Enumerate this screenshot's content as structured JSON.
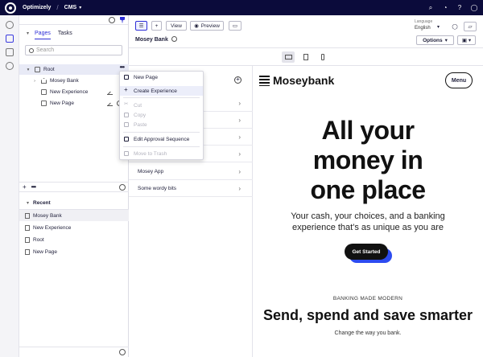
{
  "topbar": {
    "brand": "Optimizely",
    "separator": "/",
    "product": "CMS"
  },
  "tree": {
    "tabs": [
      {
        "label": "Pages"
      },
      {
        "label": "Tasks"
      }
    ],
    "search_placeholder": "Search",
    "nodes": [
      {
        "label": "Root"
      },
      {
        "label": "Mosey Bank"
      },
      {
        "label": "New Experience"
      },
      {
        "label": "New Page"
      }
    ]
  },
  "recent": {
    "title": "Recent",
    "items": [
      {
        "label": "Mosey Bank"
      },
      {
        "label": "New Experience"
      },
      {
        "label": "Root"
      },
      {
        "label": "New Page"
      }
    ]
  },
  "toolbar": {
    "view_label": "View",
    "preview_label": "Preview",
    "page_name": "Mosey Bank",
    "language_label": "Language",
    "language_value": "English",
    "options_label": "Options"
  },
  "context_menu": {
    "items": [
      {
        "label": "New Page",
        "disabled": false
      },
      {
        "label": "Create Experience",
        "disabled": false
      },
      {
        "label": "Cut",
        "disabled": true
      },
      {
        "label": "Copy",
        "disabled": true
      },
      {
        "label": "Paste",
        "disabled": true
      },
      {
        "label": "Edit Approval Sequence",
        "disabled": false
      },
      {
        "label": "Move to Trash",
        "disabled": true
      }
    ]
  },
  "content_list": {
    "items": [
      {
        "label": "Mosey App"
      },
      {
        "label": "Some wordy bits"
      }
    ]
  },
  "preview": {
    "logo_text": "Moseybank",
    "menu_label": "Menu",
    "hero_line1": "All your",
    "hero_line2": "money in",
    "hero_line3": "one place",
    "sub_line1": "Your cash, your choices, and a banking",
    "sub_line2": "experience that's as unique as you are",
    "cta_label": "Get Started",
    "eyebrow": "BANKING MADE MODERN",
    "heading2": "Send, spend and save smarter",
    "tagline": "Change the way you bank."
  },
  "colors": {
    "topbar_bg": "#0b0b3b",
    "accent": "#2d2dd6",
    "cta_shadow": "#2d4bf0"
  }
}
